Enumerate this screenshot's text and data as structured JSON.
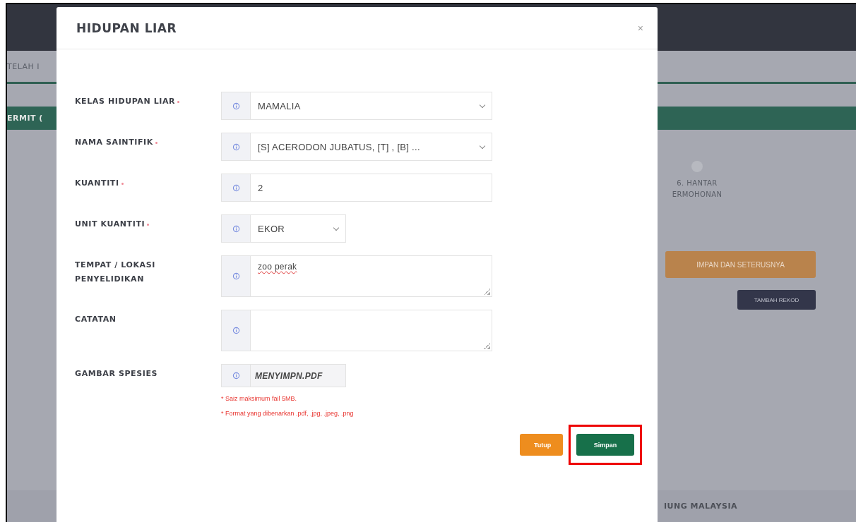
{
  "background": {
    "tab_label": "TELAH I",
    "banner_label": "ERMIT (",
    "step": {
      "number_label": "6. HANTAR",
      "name": "ERMOHONAN",
      "done": false
    },
    "primary_button": "IMPAN DAN SETERUSNYA",
    "add_button": "TAMBAH REKOD",
    "footer": "IUNG MALAYSIA"
  },
  "modal": {
    "title": "HIDUPAN LIAR",
    "close": "×",
    "fields": [
      {
        "kind": "select",
        "label": "KELAS HIDUPAN LIAR",
        "required": true,
        "value": "MAMALIA"
      },
      {
        "kind": "select",
        "label": "NAMA SAINTIFIK",
        "required": true,
        "value": "[S] ACERODON JUBATUS, [T] , [B] ..."
      },
      {
        "kind": "text",
        "label": "KUANTITI",
        "required": true,
        "value": "2"
      },
      {
        "kind": "short_select",
        "label": "UNIT KUANTITI",
        "required": true,
        "value": "EKOR"
      },
      {
        "kind": "textarea",
        "label": "TEMPAT / LOKASI PENYELIDIKAN",
        "required": false,
        "value": "zoo perak",
        "misspelled": true
      },
      {
        "kind": "textarea",
        "label": "CATATAN",
        "required": false
      },
      {
        "kind": "file",
        "label": "GAMBAR SPESIES",
        "required": false,
        "value": "MENYIMPN.PDF",
        "notes": [
          "* Saiz maksimum fail 5MB.",
          "* Format yang dibenarkan .pdf, .jpg, .jpeg, .png"
        ]
      }
    ],
    "buttons": [
      {
        "kind": "close",
        "label": "Tutup",
        "highlighted": false
      },
      {
        "kind": "save",
        "label": "Simpan",
        "highlighted": true
      }
    ]
  }
}
